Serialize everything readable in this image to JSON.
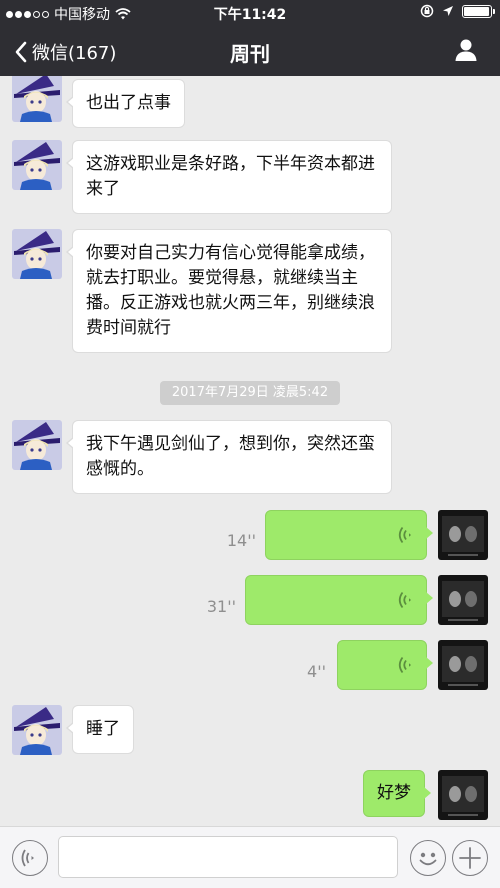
{
  "status_bar": {
    "carrier": "中国移动",
    "time": "下午11:42",
    "battery_level": 0.95
  },
  "nav": {
    "back_label": "微信(167)",
    "title": "周刊"
  },
  "messages": {
    "m1": "也出了点事",
    "m2": "这游戏职业是条好路，下半年资本都进来了",
    "m3": "你要对自己实力有信心觉得能拿成绩，就去打职业。要觉得悬，就继续当主播。反正游戏也就火两三年，别继续浪费时间就行",
    "time_divider": "2017年7月29日 凌晨5:42",
    "m4": "我下午遇见剑仙了，想到你，突然还蛮感慨的。",
    "v1_duration": "14''",
    "v2_duration": "31''",
    "v3_duration": "4''",
    "m5": "睡了",
    "m6": "好梦"
  },
  "input": {
    "placeholder": ""
  },
  "icons": {
    "back": "chevron-left-icon",
    "profile": "person-icon",
    "voice": "voice-wave-icon",
    "voice_toggle": "voice-input-icon",
    "emoji": "emoji-icon",
    "add": "plus-icon"
  },
  "colors": {
    "bar": "#2e2e33",
    "chat_bg": "#ebebeb",
    "sent_bubble": "#9eea6a",
    "received_bubble": "#ffffff"
  }
}
